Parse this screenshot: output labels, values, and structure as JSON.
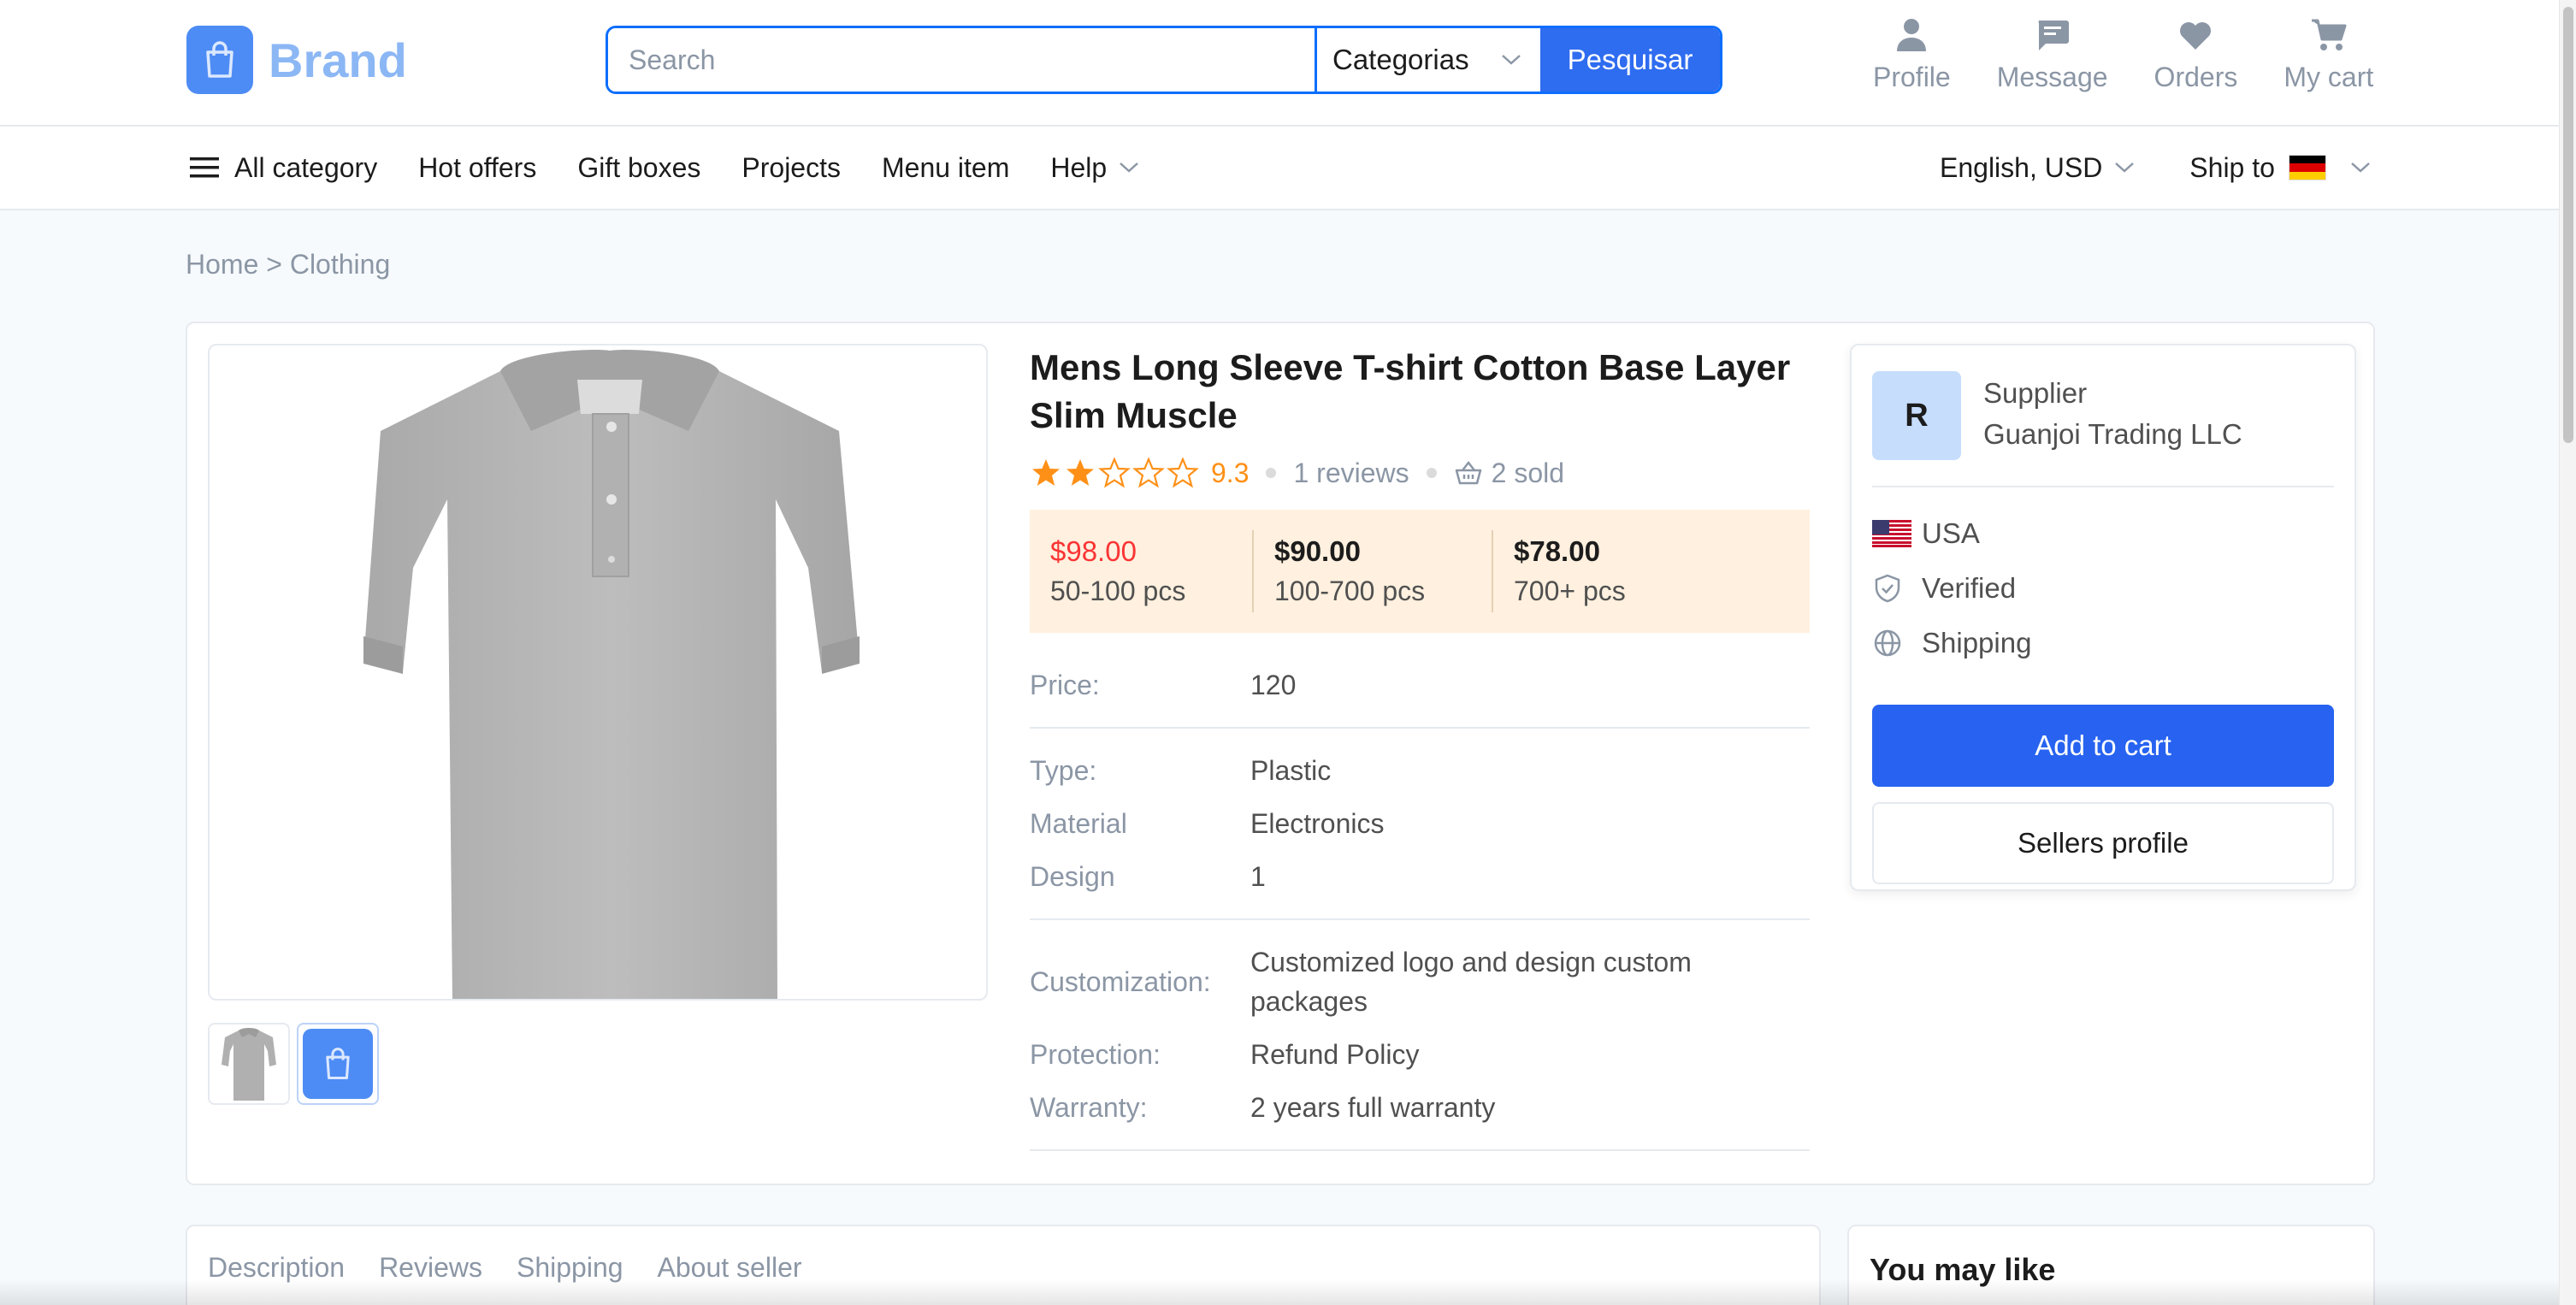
{
  "header": {
    "brand": "Brand",
    "search": {
      "placeholder": "Search",
      "category": "Categorias",
      "button": "Pesquisar"
    },
    "actions": [
      {
        "label": "Profile",
        "icon": "person-icon"
      },
      {
        "label": "Message",
        "icon": "message-icon"
      },
      {
        "label": "Orders",
        "icon": "heart-icon"
      },
      {
        "label": "My cart",
        "icon": "cart-icon"
      }
    ]
  },
  "nav": {
    "all_category": "All category",
    "items": [
      "Hot offers",
      "Gift boxes",
      "Projects",
      "Menu item",
      "Help"
    ],
    "language": "English, USD",
    "ship_to": "Ship to"
  },
  "breadcrumb": "Home > Clothing",
  "product": {
    "title": "Mens Long Sleeve T-shirt Cotton Base Layer Slim Muscle",
    "rating": {
      "stars_filled": 2,
      "stars_total": 5,
      "score": "9.3"
    },
    "reviews": "1 reviews",
    "sold": "2 sold",
    "tiers": [
      {
        "price": "$98.00",
        "qty": "50-100 pcs"
      },
      {
        "price": "$90.00",
        "qty": "100-700 pcs"
      },
      {
        "price": "$78.00",
        "qty": "700+ pcs"
      }
    ],
    "specs": {
      "price": {
        "label": "Price:",
        "value": "120"
      },
      "type": {
        "label": "Type:",
        "value": "Plastic"
      },
      "material": {
        "label": "Material",
        "value": "Electronics"
      },
      "design": {
        "label": "Design",
        "value": "1"
      },
      "customization": {
        "label": "Customization:",
        "value": "Customized logo and design custom packages"
      },
      "protection": {
        "label": "Protection:",
        "value": "Refund Policy"
      },
      "warranty": {
        "label": "Warranty:",
        "value": "2 years full warranty"
      }
    }
  },
  "supplier": {
    "initial": "R",
    "label": "Supplier",
    "name": "Guanjoi Trading LLC",
    "country": "USA",
    "verified": "Verified",
    "shipping": "Shipping",
    "add_to_cart": "Add to cart",
    "sellers_profile": "Sellers profile"
  },
  "tabs": [
    "Description",
    "Reviews",
    "Shipping",
    "About seller"
  ],
  "you_may_like": "You may like",
  "colors": {
    "primary": "#2763f0",
    "accent_orange": "#ff9017",
    "price_red": "#fa3434",
    "tier_bg": "#fff0df"
  }
}
